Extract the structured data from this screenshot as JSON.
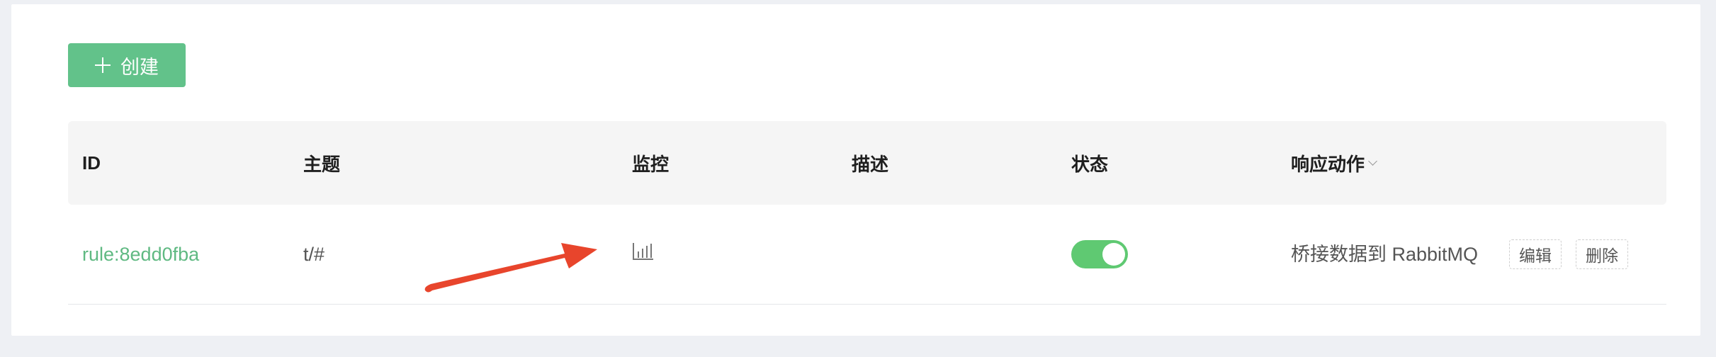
{
  "toolbar": {
    "create_label": "创建"
  },
  "table": {
    "columns": {
      "id": "ID",
      "topic": "主题",
      "monitor": "监控",
      "description": "描述",
      "status": "状态",
      "actions": "响应动作"
    },
    "rows": [
      {
        "id": "rule:8edd0fba",
        "topic": "t/#",
        "monitor_icon": "bar-chart-icon",
        "description": "",
        "enabled": true,
        "action": "桥接数据到 RabbitMQ",
        "edit_label": "编辑",
        "delete_label": "删除"
      }
    ]
  },
  "colors": {
    "brand": "#62c28a",
    "toggle_on": "#5fc972",
    "annotation_arrow": "#e8452c"
  }
}
